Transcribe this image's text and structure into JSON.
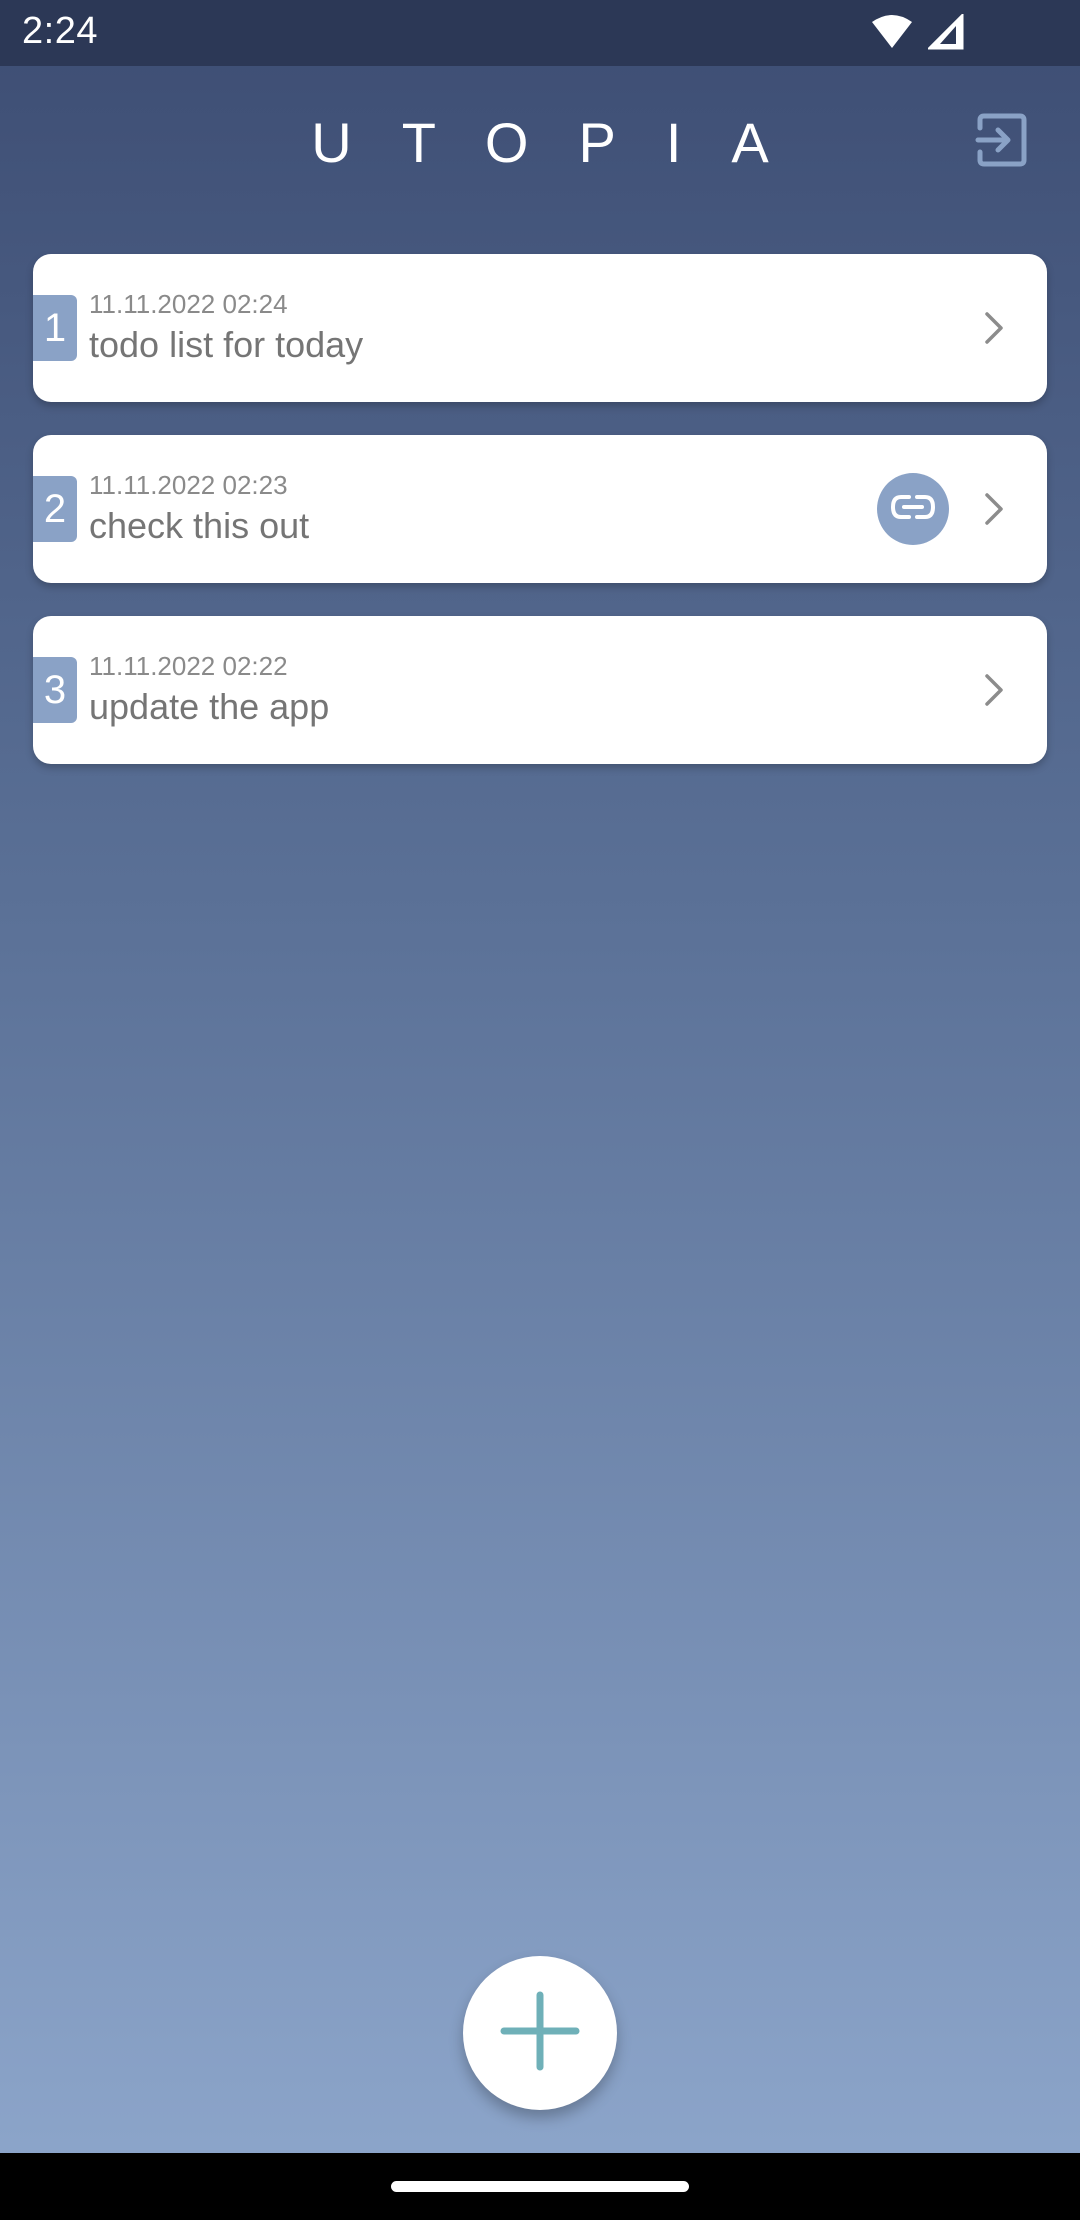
{
  "status_bar": {
    "time": "2:24",
    "icons": [
      "wifi-icon",
      "cell-signal-icon"
    ]
  },
  "header": {
    "title": "UTOPIA",
    "action_icon": "logout-icon"
  },
  "notes": [
    {
      "index": "1",
      "date": "11.11.2022 02:24",
      "title": "todo list for today",
      "has_link": false
    },
    {
      "index": "2",
      "date": "11.11.2022 02:23",
      "title": "check this out",
      "has_link": true
    },
    {
      "index": "3",
      "date": "11.11.2022 02:22",
      "title": "update the app",
      "has_link": false
    }
  ],
  "fab": {
    "icon": "plus-icon"
  },
  "colors": {
    "background_top": "#3d4d73",
    "background_bottom": "#8ea7cc",
    "accent": "#8aa2c6",
    "fab_plus": "#6fb0b8"
  }
}
